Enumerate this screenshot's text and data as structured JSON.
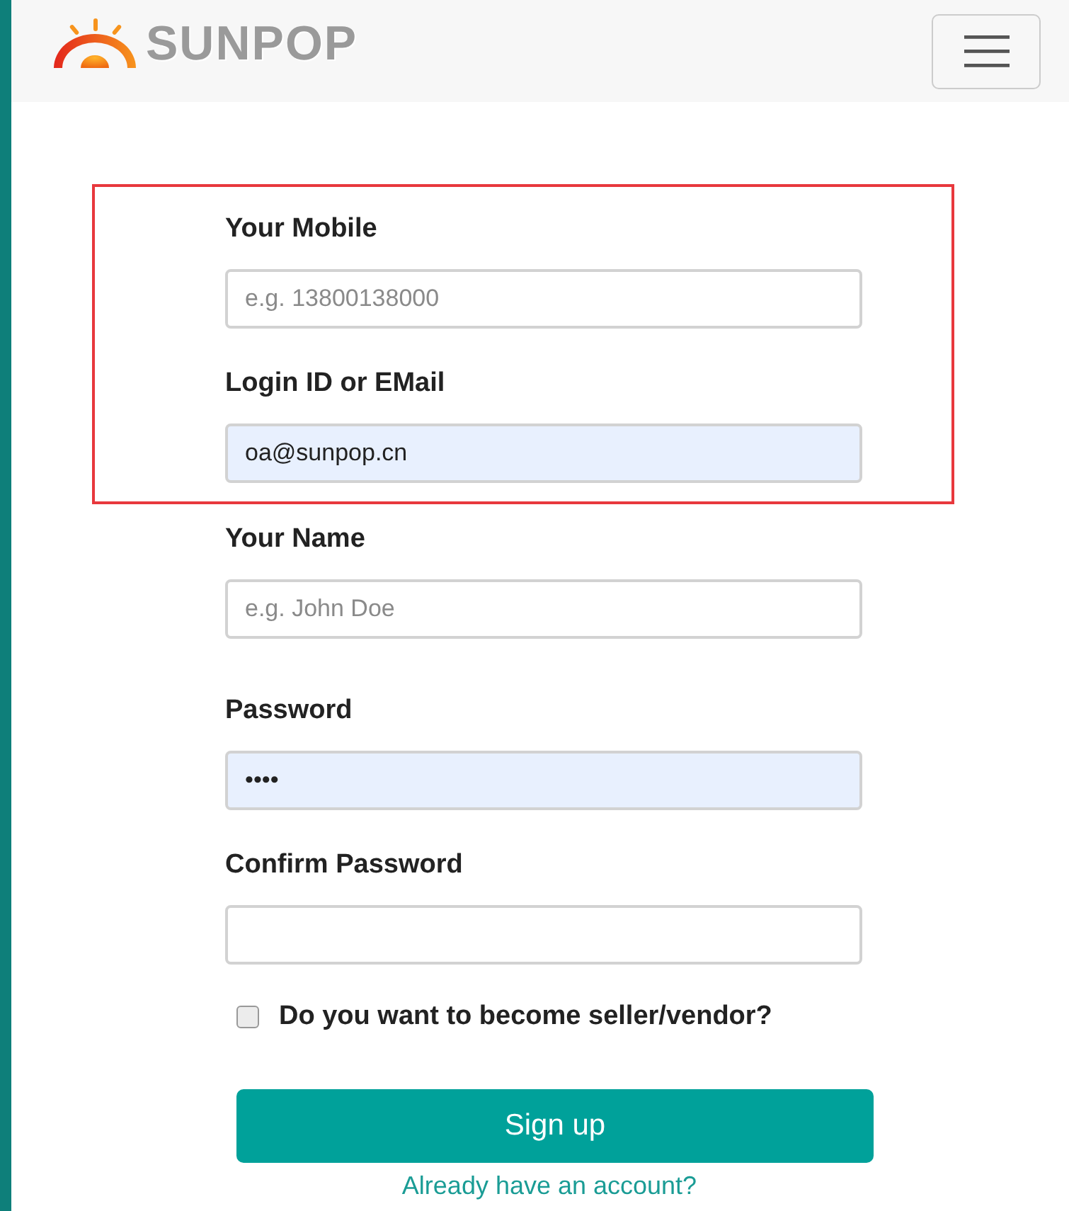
{
  "header": {
    "logo_text": "SUNPOP",
    "menu_expanded": false
  },
  "highlighted_fields": [
    {
      "label": "Your Mobile",
      "placeholder": "e.g. 13800138000",
      "autofilled": false
    },
    {
      "label": "Login ID or EMail",
      "value": "oa@sunpop.cn",
      "autofilled": true
    }
  ],
  "fields": [
    {
      "label": "Your Name",
      "placeholder": "e.g. John Doe",
      "autofilled": false
    },
    {
      "label": "Password",
      "value": "••••",
      "autofilled": true
    },
    {
      "label": "Confirm Password",
      "autofilled": false
    }
  ],
  "seller_checkbox": {
    "label": "Do you want to become seller/vendor?",
    "checked": false
  },
  "submit_button": "Sign up",
  "login_link": "Already have an account?"
}
